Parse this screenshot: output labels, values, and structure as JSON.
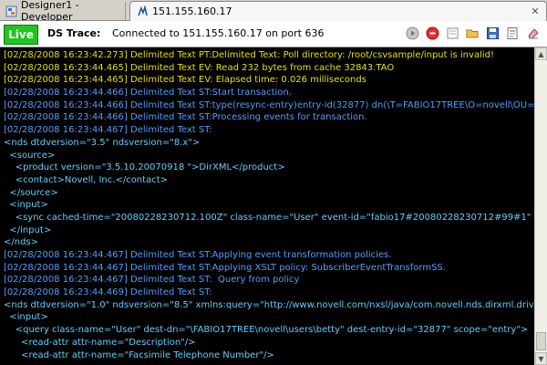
{
  "tabs": [
    {
      "label": "Designer1 - Developer",
      "active": false
    },
    {
      "label": "151.155.160.17",
      "active": true,
      "dirty_marker": ""
    }
  ],
  "toolbar": {
    "live": "Live",
    "trace_label": "DS Trace:",
    "status": "Connected to 151.155.160.17 on port 636"
  },
  "colors": {
    "live_bg": "#1fc61f",
    "trace_blue": "#4f9fff",
    "trace_yellow": "#e8e000",
    "trace_xml": "#5fd0ff",
    "console_bg": "#000000"
  },
  "console_lines": [
    {
      "text": "[02/28/2008 16:23:42.273] Delimited Text PT:Delimited Text: Poll directory: /root/csvsample/input is invalid!",
      "color": "yellow"
    },
    {
      "text": "[02/28/2008 16:23:44.465] Delimited Text EV: Read 232 bytes from cache 32843.TAO",
      "color": "yellow"
    },
    {
      "text": "[02/28/2008 16:23:44.465] Delimited Text EV: Elapsed time: 0.026 milliseconds",
      "color": "yellow"
    },
    {
      "text": "[02/28/2008 16:23:44.466] Delimited Text ST:Start transaction.",
      "color": "blue"
    },
    {
      "text": "[02/28/2008 16:23:44.466] Delimited Text ST:type(resync-entry)entry-id(32877) dn(\\T=FABIO17TREE\\O=novell\\OU=users\\CN=",
      "color": "blue"
    },
    {
      "text": "[02/28/2008 16:23:44.466] Delimited Text ST:Processing events for transaction.",
      "color": "blue"
    },
    {
      "text": "[02/28/2008 16:23:44.467] Delimited Text ST:",
      "color": "blue"
    },
    {
      "text": "<nds dtdversion=\"3.5\" ndsversion=\"8.x\">",
      "color": "xml"
    },
    {
      "text": "  <source>",
      "color": "xml"
    },
    {
      "text": "    <product version=\"3.5.10.20070918 \">DirXML</product>",
      "color": "xml"
    },
    {
      "text": "    <contact>Novell, Inc.</contact>",
      "color": "xml"
    },
    {
      "text": "  </source>",
      "color": "xml"
    },
    {
      "text": "  <input>",
      "color": "xml"
    },
    {
      "text": "    <sync cached-time=\"20080228230712.100Z\" class-name=\"User\" event-id=\"fabio17#20080228230712#99#1\" qualified-src-d",
      "color": "xml"
    },
    {
      "text": "  </input>",
      "color": "xml"
    },
    {
      "text": "</nds>",
      "color": "xml"
    },
    {
      "text": "[02/28/2008 16:23:44.467] Delimited Text ST:Applying event transformation policies.",
      "color": "blue"
    },
    {
      "text": "[02/28/2008 16:23:44.467] Delimited Text ST:Applying XSLT policy: SubscriberEventTransformSS.",
      "color": "blue"
    },
    {
      "text": "[02/28/2008 16:23:44.467] Delimited Text ST:  Query from policy",
      "color": "blue"
    },
    {
      "text": "[02/28/2008 16:23:44.469] Delimited Text ST:",
      "color": "blue"
    },
    {
      "text": "<nds dtdversion=\"1.0\" ndsversion=\"8.5\" xmlns:query=\"http://www.novell.com/nxsl/java/com.novell.nds.dirxml.driver.XdsQuery",
      "color": "xml"
    },
    {
      "text": "  <input>",
      "color": "xml"
    },
    {
      "text": "    <query class-name=\"User\" dest-dn=\"\\FABIO17TREE\\novell\\users\\betty\" dest-entry-id=\"32877\" scope=\"entry\">",
      "color": "xml"
    },
    {
      "text": "      <read-attr attr-name=\"Description\"/>",
      "color": "xml"
    },
    {
      "text": "      <read-attr attr-name=\"Facsimile Telephone Number\"/>",
      "color": "xml"
    }
  ]
}
